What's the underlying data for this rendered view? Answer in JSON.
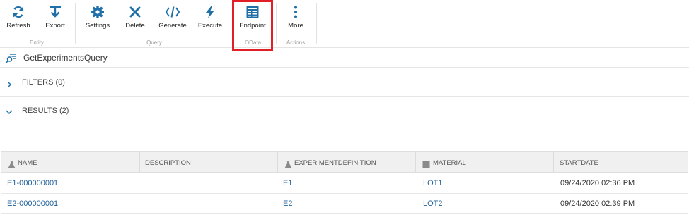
{
  "toolbar": {
    "groups": {
      "entity": "Entity",
      "query": "Query",
      "odata": "OData",
      "actions": "Actions"
    },
    "buttons": {
      "refresh": "Refresh",
      "export": "Export",
      "settings": "Settings",
      "delete": "Delete",
      "generate": "Generate",
      "execute": "Execute",
      "endpoint": "Endpoint",
      "more": "More"
    },
    "icon_color": "#1f6fa8",
    "highlight_color": "#e21f26"
  },
  "query": {
    "title": "GetExperimentsQuery"
  },
  "filters": {
    "label": "FILTERS (0)"
  },
  "results": {
    "label": "RESULTS (2)"
  },
  "table": {
    "columns": [
      "NAME",
      "DESCRIPTION",
      "EXPERIMENTDEFINITION",
      "MATERIAL",
      "STARTDATE"
    ],
    "rows": [
      {
        "name": "E1-000000001",
        "description": "",
        "definition": "E1",
        "material": "LOT1",
        "startdate": "09/24/2020 02:36 PM"
      },
      {
        "name": "E2-000000001",
        "description": "",
        "definition": "E2",
        "material": "LOT2",
        "startdate": "09/24/2020 02:39 PM"
      }
    ]
  }
}
